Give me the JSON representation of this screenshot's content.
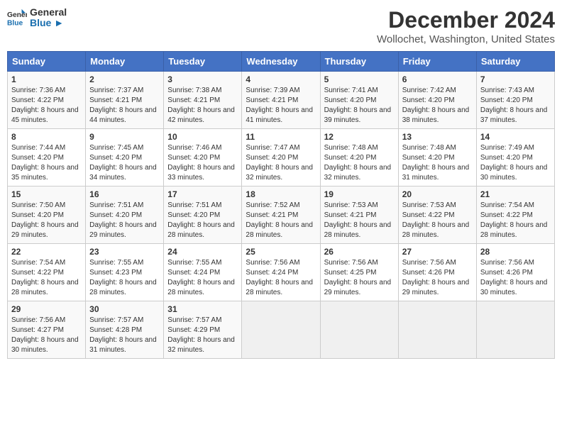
{
  "logo": {
    "text_general": "General",
    "text_blue": "Blue"
  },
  "header": {
    "title": "December 2024",
    "subtitle": "Wollochet, Washington, United States"
  },
  "weekdays": [
    "Sunday",
    "Monday",
    "Tuesday",
    "Wednesday",
    "Thursday",
    "Friday",
    "Saturday"
  ],
  "weeks": [
    [
      {
        "day": "1",
        "sunrise": "7:36 AM",
        "sunset": "4:22 PM",
        "daylight": "8 hours and 45 minutes."
      },
      {
        "day": "2",
        "sunrise": "7:37 AM",
        "sunset": "4:21 PM",
        "daylight": "8 hours and 44 minutes."
      },
      {
        "day": "3",
        "sunrise": "7:38 AM",
        "sunset": "4:21 PM",
        "daylight": "8 hours and 42 minutes."
      },
      {
        "day": "4",
        "sunrise": "7:39 AM",
        "sunset": "4:21 PM",
        "daylight": "8 hours and 41 minutes."
      },
      {
        "day": "5",
        "sunrise": "7:41 AM",
        "sunset": "4:20 PM",
        "daylight": "8 hours and 39 minutes."
      },
      {
        "day": "6",
        "sunrise": "7:42 AM",
        "sunset": "4:20 PM",
        "daylight": "8 hours and 38 minutes."
      },
      {
        "day": "7",
        "sunrise": "7:43 AM",
        "sunset": "4:20 PM",
        "daylight": "8 hours and 37 minutes."
      }
    ],
    [
      {
        "day": "8",
        "sunrise": "7:44 AM",
        "sunset": "4:20 PM",
        "daylight": "8 hours and 35 minutes."
      },
      {
        "day": "9",
        "sunrise": "7:45 AM",
        "sunset": "4:20 PM",
        "daylight": "8 hours and 34 minutes."
      },
      {
        "day": "10",
        "sunrise": "7:46 AM",
        "sunset": "4:20 PM",
        "daylight": "8 hours and 33 minutes."
      },
      {
        "day": "11",
        "sunrise": "7:47 AM",
        "sunset": "4:20 PM",
        "daylight": "8 hours and 32 minutes."
      },
      {
        "day": "12",
        "sunrise": "7:48 AM",
        "sunset": "4:20 PM",
        "daylight": "8 hours and 32 minutes."
      },
      {
        "day": "13",
        "sunrise": "7:48 AM",
        "sunset": "4:20 PM",
        "daylight": "8 hours and 31 minutes."
      },
      {
        "day": "14",
        "sunrise": "7:49 AM",
        "sunset": "4:20 PM",
        "daylight": "8 hours and 30 minutes."
      }
    ],
    [
      {
        "day": "15",
        "sunrise": "7:50 AM",
        "sunset": "4:20 PM",
        "daylight": "8 hours and 29 minutes."
      },
      {
        "day": "16",
        "sunrise": "7:51 AM",
        "sunset": "4:20 PM",
        "daylight": "8 hours and 29 minutes."
      },
      {
        "day": "17",
        "sunrise": "7:51 AM",
        "sunset": "4:20 PM",
        "daylight": "8 hours and 28 minutes."
      },
      {
        "day": "18",
        "sunrise": "7:52 AM",
        "sunset": "4:21 PM",
        "daylight": "8 hours and 28 minutes."
      },
      {
        "day": "19",
        "sunrise": "7:53 AM",
        "sunset": "4:21 PM",
        "daylight": "8 hours and 28 minutes."
      },
      {
        "day": "20",
        "sunrise": "7:53 AM",
        "sunset": "4:22 PM",
        "daylight": "8 hours and 28 minutes."
      },
      {
        "day": "21",
        "sunrise": "7:54 AM",
        "sunset": "4:22 PM",
        "daylight": "8 hours and 28 minutes."
      }
    ],
    [
      {
        "day": "22",
        "sunrise": "7:54 AM",
        "sunset": "4:22 PM",
        "daylight": "8 hours and 28 minutes."
      },
      {
        "day": "23",
        "sunrise": "7:55 AM",
        "sunset": "4:23 PM",
        "daylight": "8 hours and 28 minutes."
      },
      {
        "day": "24",
        "sunrise": "7:55 AM",
        "sunset": "4:24 PM",
        "daylight": "8 hours and 28 minutes."
      },
      {
        "day": "25",
        "sunrise": "7:56 AM",
        "sunset": "4:24 PM",
        "daylight": "8 hours and 28 minutes."
      },
      {
        "day": "26",
        "sunrise": "7:56 AM",
        "sunset": "4:25 PM",
        "daylight": "8 hours and 29 minutes."
      },
      {
        "day": "27",
        "sunrise": "7:56 AM",
        "sunset": "4:26 PM",
        "daylight": "8 hours and 29 minutes."
      },
      {
        "day": "28",
        "sunrise": "7:56 AM",
        "sunset": "4:26 PM",
        "daylight": "8 hours and 30 minutes."
      }
    ],
    [
      {
        "day": "29",
        "sunrise": "7:56 AM",
        "sunset": "4:27 PM",
        "daylight": "8 hours and 30 minutes."
      },
      {
        "day": "30",
        "sunrise": "7:57 AM",
        "sunset": "4:28 PM",
        "daylight": "8 hours and 31 minutes."
      },
      {
        "day": "31",
        "sunrise": "7:57 AM",
        "sunset": "4:29 PM",
        "daylight": "8 hours and 32 minutes."
      },
      null,
      null,
      null,
      null
    ]
  ],
  "labels": {
    "sunrise": "Sunrise:",
    "sunset": "Sunset:",
    "daylight": "Daylight:"
  }
}
